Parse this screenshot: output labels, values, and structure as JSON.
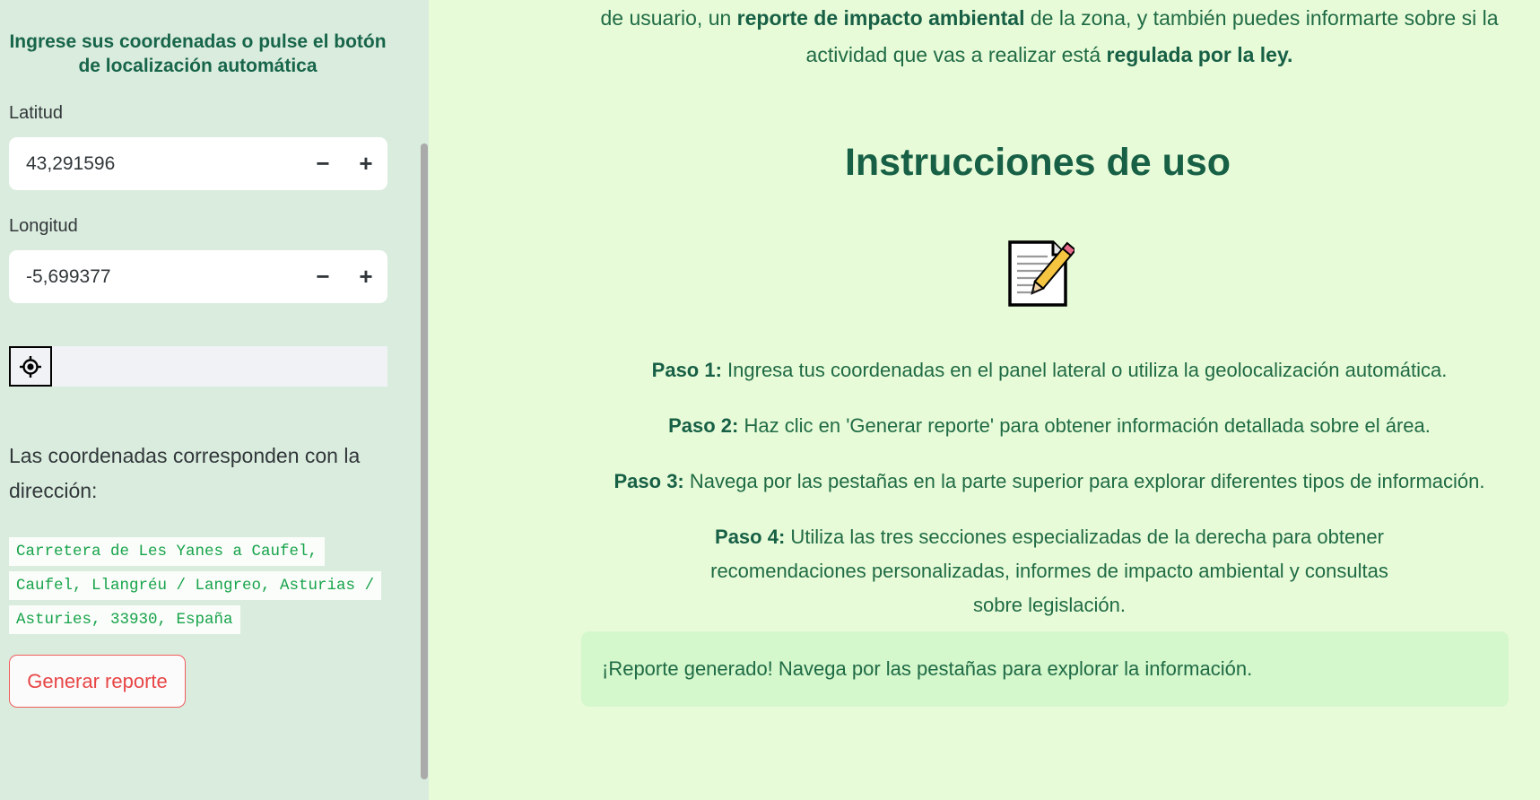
{
  "sidebar": {
    "heading": "Ingrese sus coordenadas o pulse el botón de localización automática",
    "latitude_label": "Latitud",
    "latitude_value": "43,291596",
    "longitude_label": "Longitud",
    "longitude_value": "-5,699377",
    "stepper_minus": "−",
    "stepper_plus": "+",
    "address_intro": "Las coordenadas corresponden con la dirección:",
    "address_lines": [
      "Carretera de Les Yanes a Caufel,",
      "Caufel, Llangréu / Langreo, Asturias /",
      "Asturies, 33930, España"
    ],
    "generate_button": "Generar reporte",
    "locate_icon": "crosshair-icon"
  },
  "main": {
    "intro_line1_a": "de usuario, un ",
    "intro_line1_b": "reporte de impacto ambiental",
    "intro_line1_c": " de la zona, y también puedes informarte sobre si la",
    "intro_line2_a": "actividad que vas a realizar está ",
    "intro_line2_b": "regulada por la ley.",
    "title": "Instrucciones de uso",
    "title_icon": "notepad-pencil-icon",
    "steps": [
      {
        "label": "Paso 1:",
        "text": " Ingresa tus coordenadas en el panel lateral o utiliza la geolocalización automática."
      },
      {
        "label": "Paso 2:",
        "text": " Haz clic en 'Generar reporte' para obtener información detallada sobre el área."
      },
      {
        "label": "Paso 3:",
        "text": " Navega por las pestañas en la parte superior para explorar diferentes tipos de información."
      },
      {
        "label": "Paso 4:",
        "text": " Utiliza las tres secciones especializadas de la derecha para obtener recomendaciones personalizadas, informes de impacto ambiental y consultas sobre legislación."
      }
    ],
    "success_message": "¡Reporte generado! Navega por las pestañas para explorar la información."
  },
  "colors": {
    "main_bg": "#e8fbd8",
    "sidebar_bg": "#daecde",
    "primary_green": "#176046",
    "success_bg": "#d4f7cc",
    "button_red": "#e84545",
    "code_green": "#16a34a"
  }
}
